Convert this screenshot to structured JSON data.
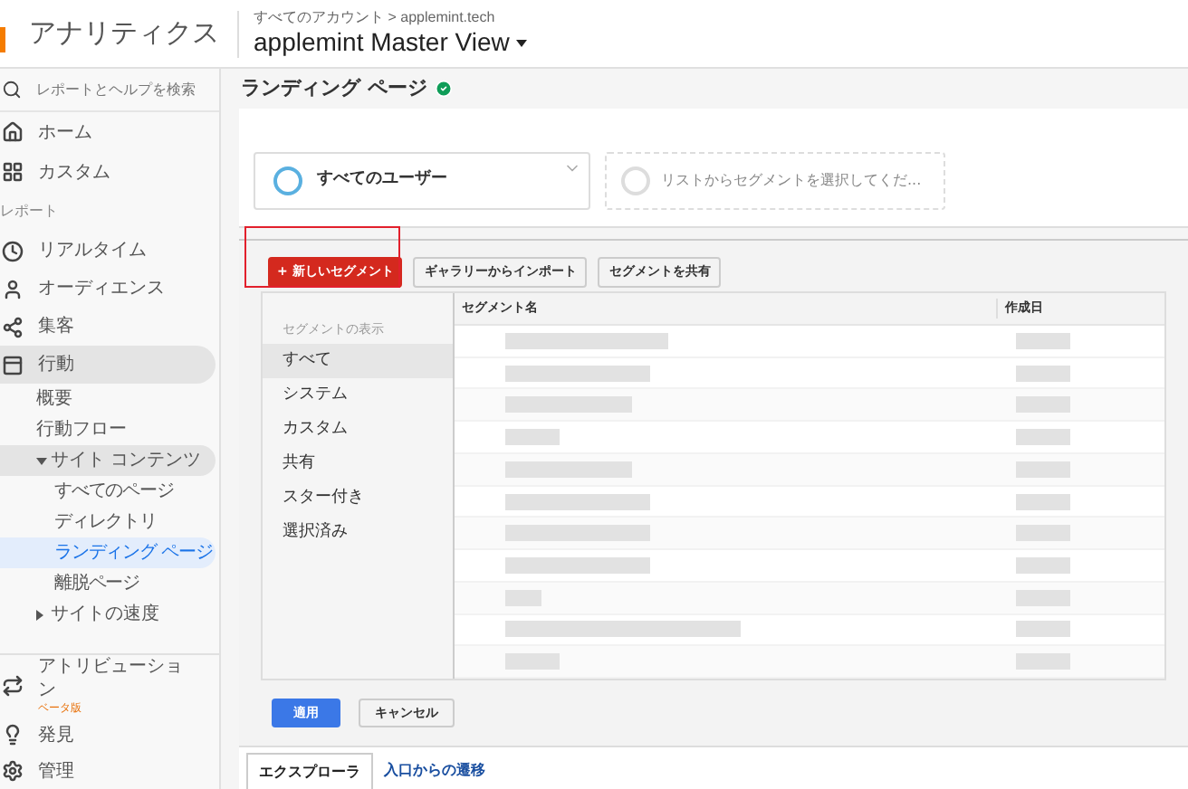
{
  "header": {
    "app_name": "アナリティクス",
    "breadcrumb": "すべてのアカウント > applemint.tech",
    "view": "applemint Master View"
  },
  "sidebar": {
    "search_placeholder": "レポートとヘルプを検索",
    "top_items": [
      {
        "kind": "home",
        "label": "ホーム"
      },
      {
        "kind": "custom",
        "label": "カスタム"
      }
    ],
    "section": "レポート",
    "items": [
      {
        "kind": "realtime",
        "label": "リアルタイム",
        "expanded": false
      },
      {
        "kind": "audience",
        "label": "オーディエンス",
        "expanded": false
      },
      {
        "kind": "acquisition",
        "label": "集客",
        "expanded": false
      },
      {
        "kind": "behavior",
        "label": "行動",
        "expanded": true,
        "children": [
          {
            "label": "概要",
            "selected": false
          },
          {
            "label": "行動フロー",
            "selected": false
          },
          {
            "label": "サイト コンテンツ",
            "expanded": true,
            "selected": false,
            "children": [
              {
                "label": "すべてのページ",
                "selected": false
              },
              {
                "label": "ディレクトリ",
                "selected": false
              },
              {
                "label": "ランディング ページ",
                "selected": true
              },
              {
                "label": "離脱ページ",
                "selected": false
              }
            ]
          },
          {
            "label": "サイトの速度",
            "expanded": false,
            "selected": false
          }
        ]
      }
    ],
    "bottom_items": [
      {
        "kind": "attribution",
        "label": "アトリビューション",
        "badge": "ベータ版"
      },
      {
        "kind": "discover",
        "label": "発見"
      },
      {
        "kind": "admin",
        "label": "管理"
      }
    ]
  },
  "page": {
    "title": "ランディング ページ",
    "verified": true
  },
  "segments": [
    {
      "kind": "active",
      "label": "すべてのユーザー"
    },
    {
      "kind": "empty",
      "label": "リストからセグメントを選択してくだ..."
    }
  ],
  "segment_panel": {
    "buttons": [
      {
        "kind": "primary",
        "label": "+ 新しいセグメント",
        "highlighted": true
      },
      {
        "kind": "default",
        "label": "ギャラリーからインポート",
        "highlighted": false
      },
      {
        "kind": "default",
        "label": "セグメントを共有",
        "highlighted": false
      }
    ],
    "filter_heading": "セグメントの表示",
    "filters": [
      {
        "label": "すべて",
        "selected": true
      },
      {
        "label": "システム",
        "selected": false
      },
      {
        "label": "カスタム",
        "selected": false
      },
      {
        "label": "共有",
        "selected": false
      },
      {
        "label": "スター付き",
        "selected": false
      },
      {
        "label": "選択済み",
        "selected": false
      }
    ],
    "columns": [
      "セグメント名",
      "作成日"
    ],
    "footer_buttons": [
      {
        "kind": "primary",
        "label": "適用"
      },
      {
        "kind": "default",
        "label": "キャンセル"
      }
    ]
  },
  "tabs": [
    {
      "label": "エクスプローラ",
      "selected": true
    },
    {
      "label": "入口からの遷移",
      "selected": false
    }
  ]
}
